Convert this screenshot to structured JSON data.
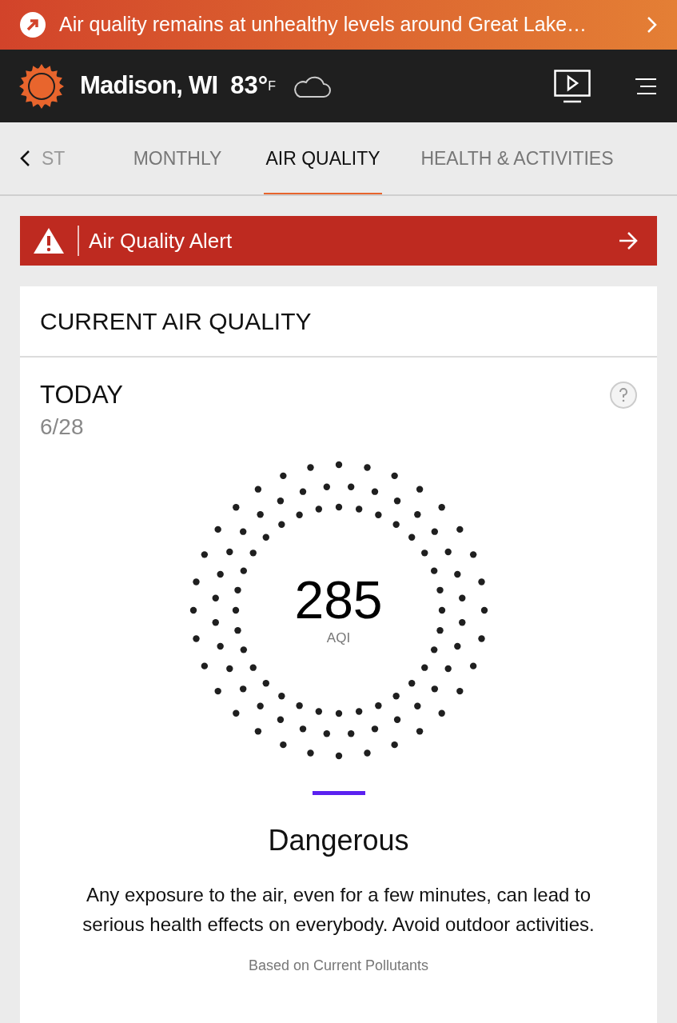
{
  "banner": {
    "text": "Air quality remains at unhealthy levels around Great Lake…"
  },
  "header": {
    "location": "Madison, WI",
    "temperature": "83°",
    "unit": "F"
  },
  "tabs": [
    {
      "label": "ST",
      "selected": false
    },
    {
      "label": "MONTHLY",
      "selected": false
    },
    {
      "label": "AIR QUALITY",
      "selected": true
    },
    {
      "label": "HEALTH & ACTIVITIES",
      "selected": false
    }
  ],
  "alert": {
    "text": "Air Quality Alert"
  },
  "card": {
    "title": "CURRENT AIR QUALITY",
    "day": "TODAY",
    "date": "6/28",
    "value": "285",
    "unit": "AQI",
    "category": "Dangerous",
    "description": "Any exposure to the air, even for a few minutes, can lead to serious health effects on everybody. Avoid outdoor activities.",
    "note": "Based on Current Pollutants"
  }
}
